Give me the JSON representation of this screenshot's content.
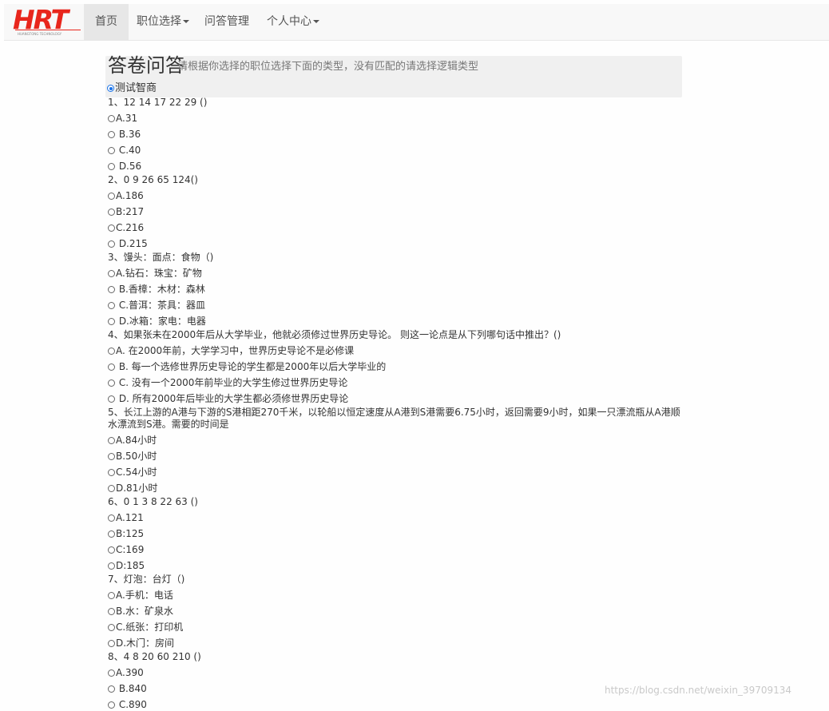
{
  "nav": {
    "logo_text": "HRT",
    "logo_tagline": "HUANGTONG TECHNOLOGY 华汇通科技",
    "items": [
      {
        "label": "首页",
        "active": true,
        "dropdown": false
      },
      {
        "label": "职位选择",
        "active": false,
        "dropdown": true
      },
      {
        "label": "问答管理",
        "active": false,
        "dropdown": false
      },
      {
        "label": "个人中心",
        "active": false,
        "dropdown": true
      }
    ]
  },
  "header": {
    "title": "答卷问答",
    "subtitle": "请根据你选择的职位选择下面的类型，没有匹配的请选择逻辑类型"
  },
  "category": {
    "label": "测试智商",
    "checked": true
  },
  "questions": [
    {
      "text": "1、12 14 17 22 29 ()",
      "options": [
        "A.31",
        " B.36",
        " C.40",
        " D.56"
      ]
    },
    {
      "text": "2、0 9 26 65 124()",
      "options": [
        "A.186",
        "B:217",
        "C.216",
        " D.215"
      ]
    },
    {
      "text": "3、馒头：面点：食物（)",
      "options": [
        "A.钻石：珠宝：矿物",
        " B.香樟：木材：森林",
        " C.普洱：茶具：器皿",
        " D.冰箱：家电：电器"
      ]
    },
    {
      "text": "4、如果张未在2000年后从大学毕业，他就必须修过世界历史导论。 则这一论点是从下列哪句话中推出？()",
      "options": [
        "A. 在2000年前，大学学习中，世界历史导论不是必修课",
        " B. 每一个选修世界历史导论的学生都是2000年以后大学毕业的",
        " C. 没有一个2000年前毕业的大学生修过世界历史导论",
        " D. 所有2000年后毕业的大学生都必须修世界历史导论"
      ]
    },
    {
      "text": "5、长江上游的A港与下游的S港相距270千米，以轮船以恒定速度从A港到S港需要6.75小时，返回需要9小时，如果一只漂流瓶从A港顺水漂流到S港。需要的时间是",
      "options": [
        "A.84小时",
        "B.50小时",
        "C.54小时",
        "D.81小时"
      ]
    },
    {
      "text": "6、0 1 3 8 22 63 ()",
      "options": [
        "A.121",
        "B:125",
        "C:169",
        "D:185"
      ]
    },
    {
      "text": "7、灯泡：台灯（)",
      "options": [
        "A.手机：电话",
        "B.水：矿泉水",
        "C.纸张：打印机",
        "D.木门：房间"
      ]
    },
    {
      "text": "8、4 8 20 60 210 ()",
      "options": [
        "A.390",
        " B.840",
        " C.890"
      ]
    }
  ],
  "watermark": "https://blog.csdn.net/weixin_39709134",
  "colors": {
    "logo_red": "#e8261c",
    "navbar_bg": "#f8f8f8",
    "panel_bg": "#f0f0f0",
    "radio_checked": "#1a73e8"
  }
}
